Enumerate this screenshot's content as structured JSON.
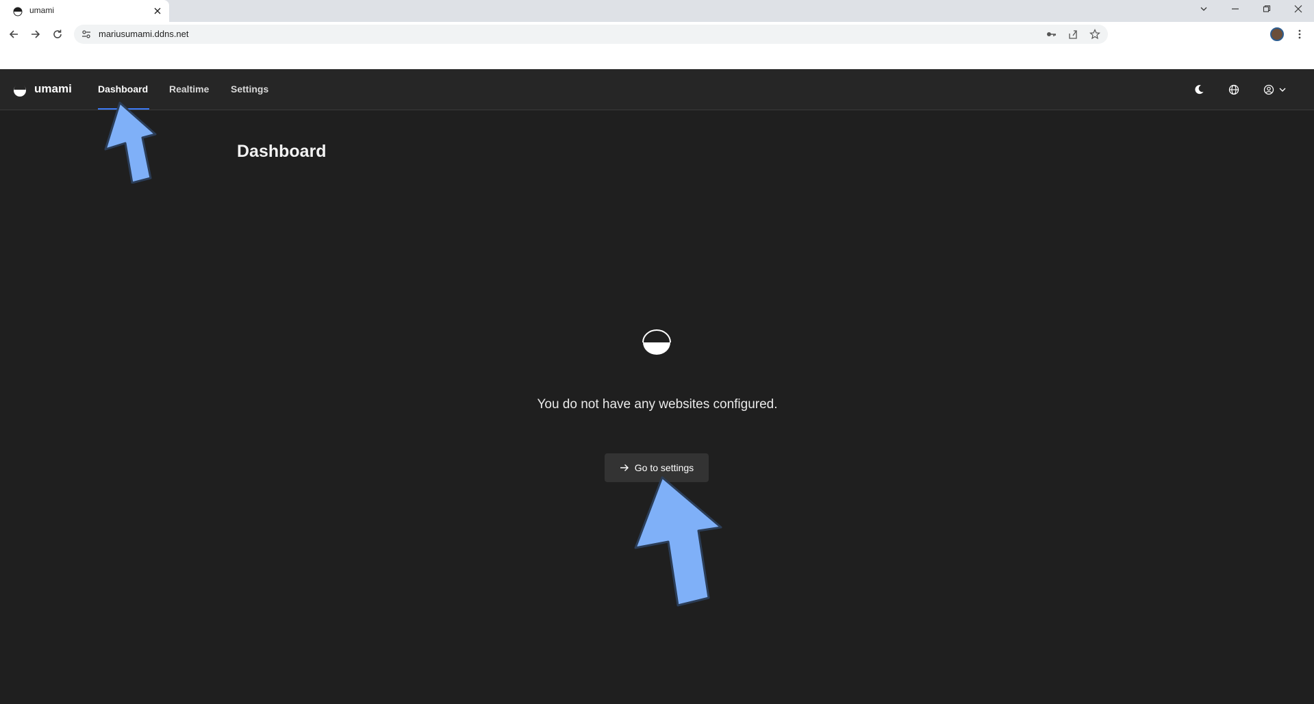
{
  "browser": {
    "tab": {
      "title": "umami"
    },
    "address_bar": {
      "url": "mariusumami.ddns.net"
    }
  },
  "header": {
    "brand": "umami",
    "nav": [
      {
        "label": "Dashboard",
        "active": true
      },
      {
        "label": "Realtime",
        "active": false
      },
      {
        "label": "Settings",
        "active": false
      }
    ],
    "icons": [
      "moon-icon",
      "globe-icon",
      "user-icon",
      "chevron-down-icon"
    ]
  },
  "main": {
    "title": "Dashboard",
    "empty_state": {
      "message": "You do not have any websites configured.",
      "button_label": "Go to settings"
    }
  },
  "colors": {
    "background": "#1f1f1f",
    "header": "#262626",
    "accent": "#3d7bf7",
    "annotation_arrow": "#7fb0f8"
  }
}
